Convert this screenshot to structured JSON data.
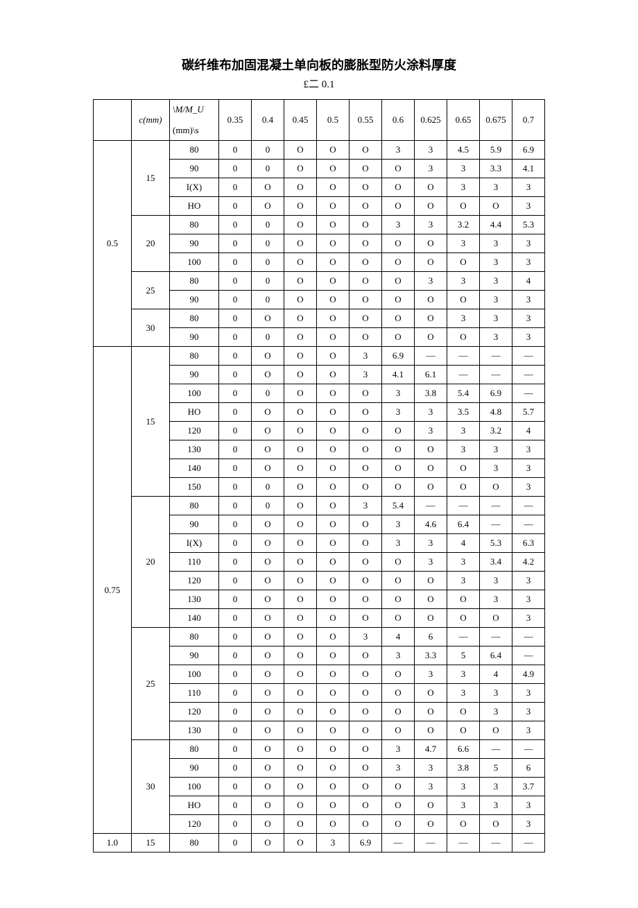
{
  "title": "碳纤维布加固混凝土单向板的膨胀型防火涂料厚度",
  "subtitle": "£二 0.1",
  "header": {
    "col0_blank": "",
    "col1": "c(mm)",
    "col2_top": "\\M/M_U",
    "col2_bottom": "(mm)\\s",
    "ratios": [
      "0.35",
      "0.4",
      "0.45",
      "0.5",
      "0.55",
      "0.6",
      "0.625",
      "0.65",
      "0.675",
      "0.7"
    ]
  },
  "blocks": [
    {
      "left": "0.5",
      "groups": [
        {
          "c": "15",
          "rows": [
            {
              "h": "80",
              "v": [
                "0",
                "0",
                "O",
                "O",
                "O",
                "3",
                "3",
                "4.5",
                "5.9",
                "6.9"
              ]
            },
            {
              "h": "90",
              "v": [
                "0",
                "0",
                "O",
                "O",
                "O",
                "O",
                "3",
                "3",
                "3.3",
                "4.1"
              ]
            },
            {
              "h": "I(X)",
              "v": [
                "0",
                "O",
                "O",
                "O",
                "O",
                "O",
                "O",
                "3",
                "3",
                "3"
              ]
            },
            {
              "h": "HO",
              "v": [
                "0",
                "O",
                "O",
                "O",
                "O",
                "O",
                "O",
                "O",
                "O",
                "3"
              ]
            }
          ]
        },
        {
          "c": "20",
          "rows": [
            {
              "h": "80",
              "v": [
                "0",
                "0",
                "O",
                "O",
                "O",
                "3",
                "3",
                "3.2",
                "4.4",
                "5.3"
              ]
            },
            {
              "h": "90",
              "v": [
                "0",
                "0",
                "O",
                "O",
                "O",
                "O",
                "O",
                "3",
                "3",
                "3"
              ]
            },
            {
              "h": "100",
              "v": [
                "0",
                "0",
                "O",
                "O",
                "O",
                "O",
                "O",
                "O",
                "3",
                "3"
              ]
            }
          ]
        },
        {
          "c": "25",
          "rows": [
            {
              "h": "80",
              "v": [
                "0",
                "0",
                "O",
                "O",
                "O",
                "O",
                "3",
                "3",
                "3",
                "4"
              ]
            },
            {
              "h": "90",
              "v": [
                "0",
                "0",
                "O",
                "O",
                "O",
                "O",
                "O",
                "O",
                "3",
                "3"
              ]
            }
          ]
        },
        {
          "c": "30",
          "rows": [
            {
              "h": "80",
              "v": [
                "0",
                "O",
                "O",
                "O",
                "O",
                "O",
                "O",
                "3",
                "3",
                "3"
              ]
            },
            {
              "h": "90",
              "v": [
                "0",
                "0",
                "O",
                "O",
                "O",
                "O",
                "O",
                "O",
                "3",
                "3"
              ]
            }
          ]
        }
      ]
    },
    {
      "left": "0.75",
      "groups": [
        {
          "c": "15",
          "rows": [
            {
              "h": "80",
              "v": [
                "0",
                "O",
                "O",
                "O",
                "3",
                "6.9",
                "—",
                "—",
                "—",
                "—"
              ]
            },
            {
              "h": "90",
              "v": [
                "0",
                "O",
                "O",
                "O",
                "3",
                "4.1",
                "6.1",
                "—",
                "—",
                "—"
              ]
            },
            {
              "h": "100",
              "v": [
                "0",
                "0",
                "O",
                "O",
                "O",
                "3",
                "3.8",
                "5.4",
                "6.9",
                "—"
              ]
            },
            {
              "h": "HO",
              "v": [
                "0",
                "O",
                "O",
                "O",
                "O",
                "3",
                "3",
                "3.5",
                "4.8",
                "5.7"
              ]
            },
            {
              "h": "120",
              "v": [
                "0",
                "O",
                "O",
                "O",
                "O",
                "O",
                "3",
                "3",
                "3.2",
                "4"
              ]
            },
            {
              "h": "130",
              "v": [
                "0",
                "O",
                "O",
                "O",
                "O",
                "O",
                "O",
                "3",
                "3",
                "3"
              ]
            },
            {
              "h": "140",
              "v": [
                "0",
                "O",
                "O",
                "O",
                "O",
                "O",
                "O",
                "O",
                "3",
                "3"
              ]
            },
            {
              "h": "150",
              "v": [
                "0",
                "0",
                "O",
                "O",
                "O",
                "O",
                "O",
                "O",
                "O",
                "3"
              ]
            }
          ]
        },
        {
          "c": "20",
          "rows": [
            {
              "h": "80",
              "v": [
                "0",
                "0",
                "O",
                "O",
                "3",
                "5.4",
                "—",
                "—",
                "—",
                "—"
              ]
            },
            {
              "h": "90",
              "v": [
                "0",
                "O",
                "O",
                "O",
                "O",
                "3",
                "4.6",
                "6.4",
                "—",
                "—"
              ]
            },
            {
              "h": "I(X)",
              "v": [
                "0",
                "O",
                "O",
                "O",
                "O",
                "3",
                "3",
                "4",
                "5.3",
                "6.3"
              ]
            },
            {
              "h": "110",
              "v": [
                "0",
                "O",
                "O",
                "O",
                "O",
                "O",
                "3",
                "3",
                "3.4",
                "4.2"
              ]
            },
            {
              "h": "120",
              "v": [
                "0",
                "O",
                "O",
                "O",
                "O",
                "O",
                "O",
                "3",
                "3",
                "3"
              ]
            },
            {
              "h": "130",
              "v": [
                "0",
                "O",
                "O",
                "O",
                "O",
                "O",
                "O",
                "O",
                "3",
                "3"
              ]
            },
            {
              "h": "140",
              "v": [
                "0",
                "O",
                "O",
                "O",
                "O",
                "O",
                "O",
                "O",
                "O",
                "3"
              ]
            }
          ]
        },
        {
          "c": "25",
          "rows": [
            {
              "h": "80",
              "v": [
                "0",
                "O",
                "O",
                "O",
                "3",
                "4",
                "6",
                "—",
                "—",
                "—"
              ]
            },
            {
              "h": "90",
              "v": [
                "0",
                "O",
                "O",
                "O",
                "O",
                "3",
                "3.3",
                "5",
                "6.4",
                "—"
              ]
            },
            {
              "h": "100",
              "v": [
                "0",
                "O",
                "O",
                "O",
                "O",
                "O",
                "3",
                "3",
                "4",
                "4.9"
              ]
            },
            {
              "h": "110",
              "v": [
                "0",
                "O",
                "O",
                "O",
                "O",
                "O",
                "O",
                "3",
                "3",
                "3"
              ]
            },
            {
              "h": "120",
              "v": [
                "0",
                "O",
                "O",
                "O",
                "O",
                "O",
                "O",
                "O",
                "3",
                "3"
              ]
            },
            {
              "h": "130",
              "v": [
                "0",
                "O",
                "O",
                "O",
                "O",
                "O",
                "O",
                "O",
                "O",
                "3"
              ]
            }
          ]
        },
        {
          "c": "30",
          "rows": [
            {
              "h": "80",
              "v": [
                "0",
                "O",
                "O",
                "O",
                "O",
                "3",
                "4.7",
                "6.6",
                "—",
                "—"
              ]
            },
            {
              "h": "90",
              "v": [
                "0",
                "O",
                "O",
                "O",
                "O",
                "3",
                "3",
                "3.8",
                "5",
                "6"
              ]
            },
            {
              "h": "100",
              "v": [
                "0",
                "O",
                "O",
                "O",
                "O",
                "O",
                "3",
                "3",
                "3",
                "3.7"
              ]
            },
            {
              "h": "HO",
              "v": [
                "0",
                "O",
                "O",
                "O",
                "O",
                "O",
                "O",
                "3",
                "3",
                "3"
              ]
            },
            {
              "h": "120",
              "v": [
                "0",
                "O",
                "O",
                "O",
                "O",
                "O",
                "O",
                "O",
                "O",
                "3"
              ]
            }
          ]
        }
      ]
    },
    {
      "left": "1.0",
      "groups": [
        {
          "c": "15",
          "rows": [
            {
              "h": "80",
              "v": [
                "0",
                "O",
                "O",
                "3",
                "6.9",
                "—",
                "—",
                "—",
                "—",
                "—"
              ]
            }
          ]
        }
      ]
    }
  ]
}
